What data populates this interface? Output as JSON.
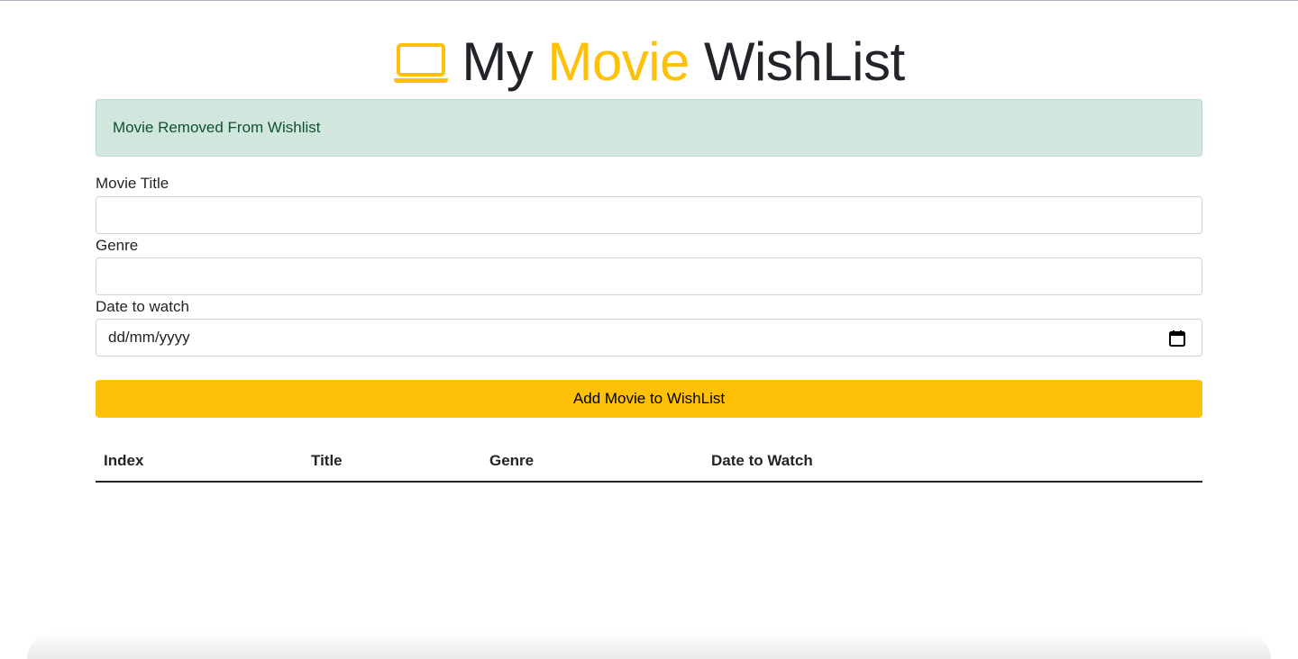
{
  "header": {
    "title_part1": "My",
    "title_accent": "Movie",
    "title_part2": "WishList",
    "icon": "laptop-icon",
    "accent_color": "#ffc107"
  },
  "alert": {
    "message": "Movie Removed From Wishlist",
    "status_color": "#d1e7dd"
  },
  "form": {
    "title_label": "Movie Title",
    "title_value": "",
    "genre_label": "Genre",
    "genre_value": "",
    "date_label": "Date to watch",
    "date_placeholder": "dd/mm/yyyy",
    "calendar_icon": "calendar-icon",
    "submit_label": "Add Movie to WishList"
  },
  "table": {
    "columns": [
      "Index",
      "Title",
      "Genre",
      "Date to Watch"
    ],
    "rows": []
  }
}
